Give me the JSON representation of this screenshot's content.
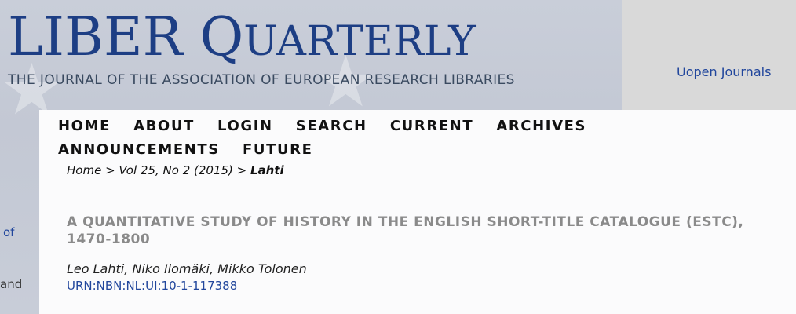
{
  "header": {
    "logo_title_first": "LIBER Q",
    "logo_title_rest": "UARTERLY",
    "logo_subtitle": "THE JOURNAL OF THE ASSOCIATION OF EUROPEAN RESEARCH LIBRARIES",
    "open_journals_link": "Uopen Journals"
  },
  "nav": {
    "items": [
      "HOME",
      "ABOUT",
      "LOGIN",
      "SEARCH",
      "CURRENT",
      "ARCHIVES",
      "ANNOUNCEMENTS",
      "FUTURE"
    ]
  },
  "breadcrumb": {
    "home": "Home",
    "sep1": " > ",
    "issue": "Vol 25, No 2 (2015)",
    "sep2": " > ",
    "current": "Lahti"
  },
  "article": {
    "title": "A QUANTITATIVE STUDY OF HISTORY IN THE ENGLISH SHORT-TITLE CATALOGUE (ESTC), 1470-1800",
    "authors": "Leo Lahti, Niko Ilomäki, Mikko Tolonen",
    "urn": "URN:NBN:NL:UI:10-1-117388"
  },
  "sidebar_fragments": {
    "link_fragment": "of",
    "text_fragment": "and"
  }
}
